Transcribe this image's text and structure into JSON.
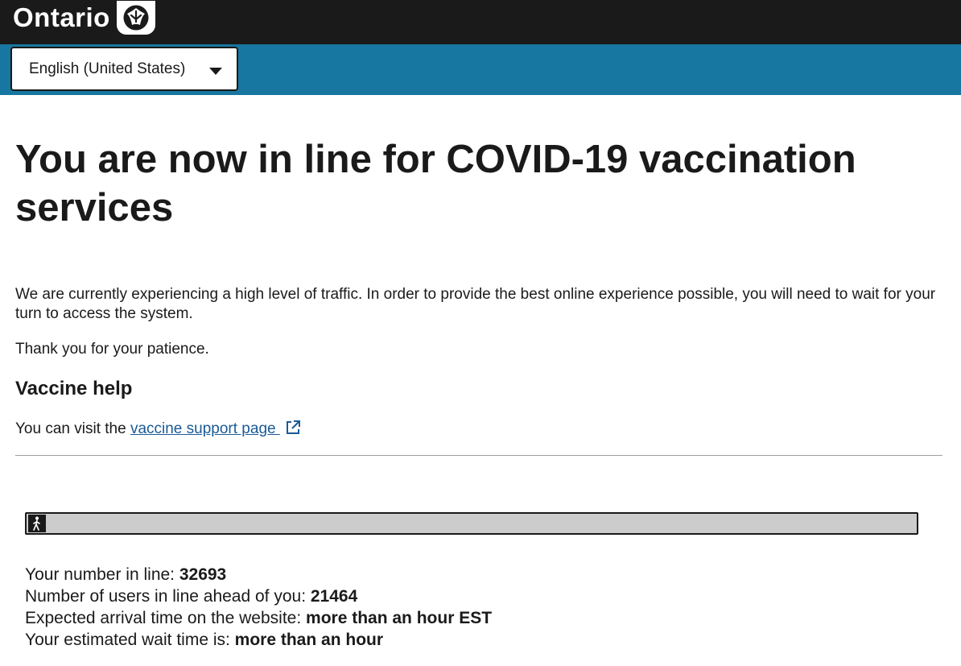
{
  "header": {
    "logo_text": "Ontario",
    "logo_icon": "ontario-trillium-icon"
  },
  "language": {
    "selected": "English (United States)"
  },
  "main": {
    "title": "You are now in line for COVID-19 vaccination services",
    "paragraph1": "We are currently experiencing a high level of traffic. In order to provide the best online experience possible, you will need to wait for your turn to access the system.",
    "paragraph2": "Thank you for your patience.",
    "help_heading": "Vaccine help",
    "help_prefix": "You can visit the ",
    "help_link": "vaccine support page ",
    "help_link_icon": "external-link-icon"
  },
  "queue": {
    "progress_percent": 0,
    "walker_icon": "walking-person-icon",
    "number_label": "Your number in line: ",
    "number_value": "32693",
    "ahead_label": "Number of users in line ahead of you: ",
    "ahead_value": "21464",
    "arrival_label": "Expected arrival time on the website: ",
    "arrival_value": "more than an hour EST",
    "wait_label": "Your estimated wait time is: ",
    "wait_value": "more than an hour"
  },
  "colors": {
    "top_bar": "#1a1a1a",
    "lang_bar": "#1777a0",
    "link": "#1a5a96",
    "progress_track": "#cccccc"
  }
}
